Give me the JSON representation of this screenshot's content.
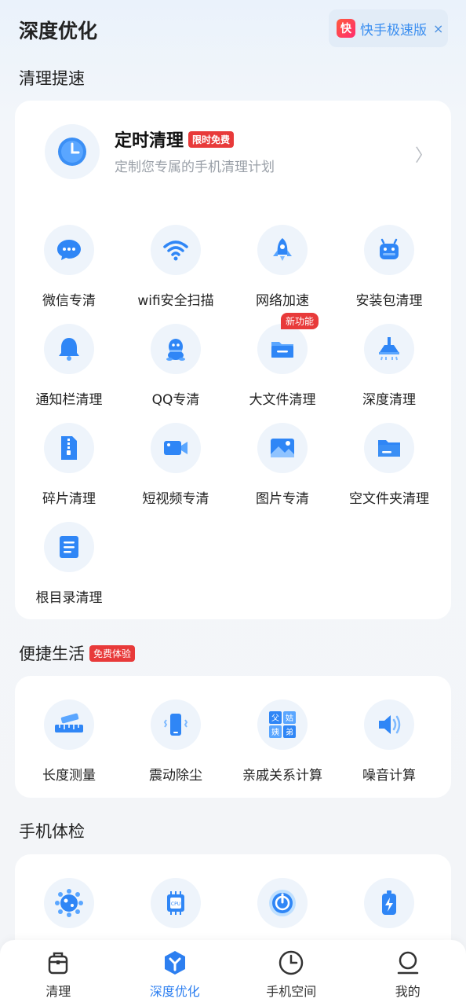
{
  "header": {
    "title": "深度优化",
    "promo": {
      "logo_char": "快",
      "label": "快手极速版",
      "close_glyph": "×"
    }
  },
  "sections": {
    "clean": {
      "title": "清理提速"
    },
    "life": {
      "title": "便捷生活",
      "badge": "免费体验"
    },
    "check": {
      "title": "手机体检"
    }
  },
  "timer": {
    "title": "定时清理",
    "badge": "限时免费",
    "subtitle": "定制您专属的手机清理计划",
    "chevron": "〉"
  },
  "clean_items": [
    {
      "label": "微信专清",
      "icon": "wechat-icon"
    },
    {
      "label": "wifi安全扫描",
      "icon": "wifi-icon"
    },
    {
      "label": "网络加速",
      "icon": "rocket-icon"
    },
    {
      "label": "安装包清理",
      "icon": "android-icon"
    },
    {
      "label": "通知栏清理",
      "icon": "bell-icon"
    },
    {
      "label": "QQ专清",
      "icon": "qq-icon"
    },
    {
      "label": "大文件清理",
      "icon": "folder-icon",
      "badge": "新功能"
    },
    {
      "label": "深度清理",
      "icon": "vacuum-icon"
    },
    {
      "label": "碎片清理",
      "icon": "zip-file-icon"
    },
    {
      "label": "短视频专清",
      "icon": "video-icon"
    },
    {
      "label": "图片专清",
      "icon": "image-icon"
    },
    {
      "label": "空文件夹清理",
      "icon": "empty-folder-icon"
    },
    {
      "label": "根目录清理",
      "icon": "document-icon"
    }
  ],
  "life_items": [
    {
      "label": "长度测量",
      "icon": "ruler-icon"
    },
    {
      "label": "震动除尘",
      "icon": "vibrate-phone-icon"
    },
    {
      "label": "亲戚关系计算",
      "icon": "relatives-icon",
      "chars": [
        "父",
        "姑",
        "姨",
        "弟"
      ]
    },
    {
      "label": "噪音计算",
      "icon": "speaker-icon"
    }
  ],
  "check_items": [
    {
      "icon": "virus-icon"
    },
    {
      "icon": "cpu-icon",
      "chip_text": "CPU"
    },
    {
      "icon": "power-icon"
    },
    {
      "icon": "battery-icon"
    }
  ],
  "tabs": [
    {
      "label": "清理",
      "icon": "broom-icon"
    },
    {
      "label": "深度优化",
      "icon": "optimize-icon",
      "active": true
    },
    {
      "label": "手机空间",
      "icon": "clock-icon"
    },
    {
      "label": "我的",
      "icon": "user-icon"
    }
  ],
  "colors": {
    "accent": "#2d7ff0",
    "icon_bg": "#eef4fb",
    "badge_red": "#e83a3a"
  }
}
